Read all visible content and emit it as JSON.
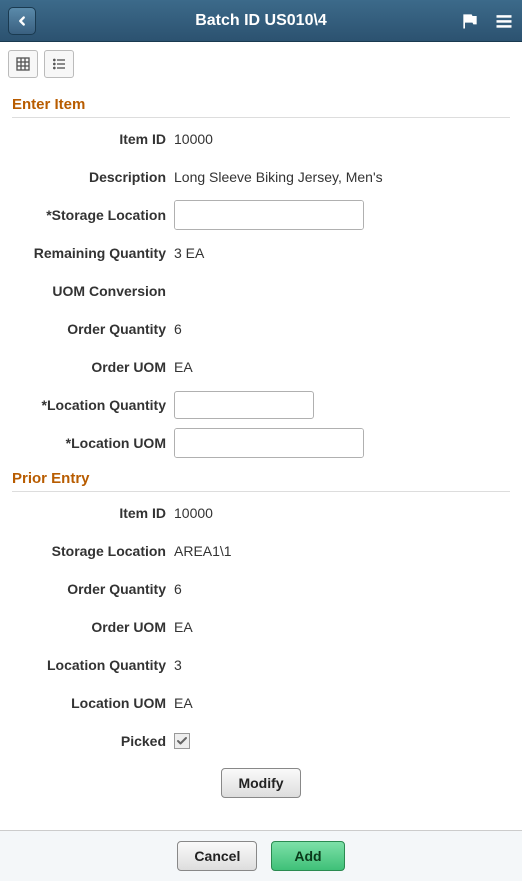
{
  "header": {
    "title": "Batch ID US010\\4"
  },
  "sections": {
    "enter_item": {
      "title": "Enter Item",
      "item_id_label": "Item ID",
      "item_id": "10000",
      "description_label": "Description",
      "description": "Long Sleeve Biking Jersey, Men's",
      "storage_location_label": "*Storage Location",
      "storage_location": "",
      "remaining_qty_label": "Remaining Quantity",
      "remaining_qty": "3 EA",
      "uom_conversion_label": "UOM Conversion",
      "order_qty_label": "Order Quantity",
      "order_qty": "6",
      "order_uom_label": "Order UOM",
      "order_uom": "EA",
      "location_qty_label": "*Location Quantity",
      "location_qty": "",
      "location_uom_label": "*Location UOM",
      "location_uom": ""
    },
    "prior_entry": {
      "title": "Prior Entry",
      "item_id_label": "Item ID",
      "item_id": "10000",
      "storage_location_label": "Storage Location",
      "storage_location": "AREA1\\1",
      "order_qty_label": "Order Quantity",
      "order_qty": "6",
      "order_uom_label": "Order UOM",
      "order_uom": "EA",
      "location_qty_label": "Location Quantity",
      "location_qty": "3",
      "location_uom_label": "Location UOM",
      "location_uom": "EA",
      "picked_label": "Picked",
      "picked": true
    }
  },
  "buttons": {
    "modify": "Modify",
    "cancel": "Cancel",
    "add": "Add"
  }
}
